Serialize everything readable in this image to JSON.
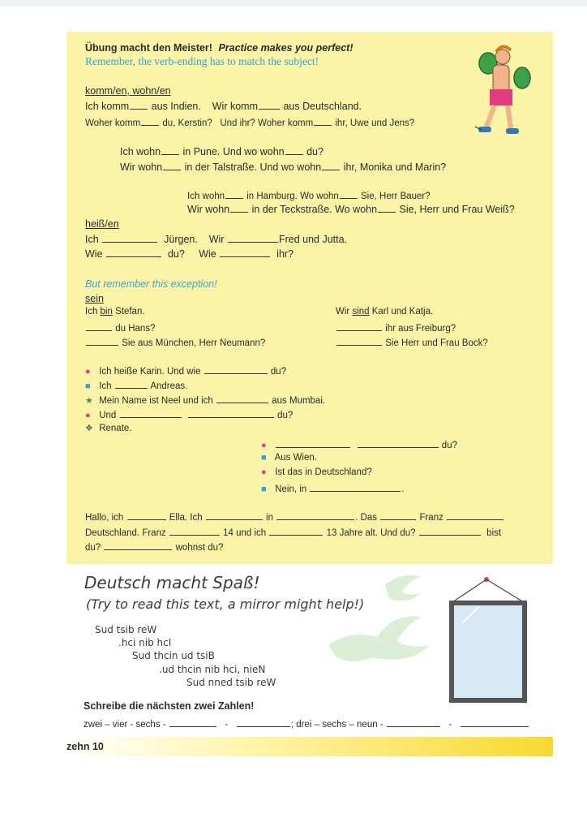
{
  "exercise": {
    "title_de": "Übung macht den Meister!",
    "title_en": "Practice makes you perfect!",
    "reminder": "Remember, the verb-ending has to match the subject!"
  },
  "section_komm": {
    "heading": "komm/en, wohn/en",
    "l1a": "Ich komm",
    "l1b": "aus Indien.",
    "l1c": "Wir komm",
    "l1d": "aus Deutschland.",
    "l2a": "Woher komm",
    "l2b": "du, Kerstin?",
    "l2c": "Und ihr? Woher komm",
    "l2d": "ihr, Uwe und Jens?",
    "l3a": "Ich wohn",
    "l3b": "in Pune. Und wo wohn",
    "l3c": "du?",
    "l4a": "Wir wohn",
    "l4b": "in der Talstraße. Und wo wohn",
    "l4c": "ihr, Monika und Marin?",
    "l5a": "Ich wohn",
    "l5b": "in Hamburg. Wo wohn",
    "l5c": "Sie, Herr Bauer?",
    "l6a": "Wir wohn",
    "l6b": "in der Teckstraße. Wo wohn",
    "l6c": "Sie, Herr und Frau Weiß?"
  },
  "section_heiss": {
    "heading": "heiß/en",
    "l1a": "Ich",
    "l1b": "Jürgen.",
    "l1c": "Wir",
    "l1d": "Fred und Jutta.",
    "l2a": "Wie",
    "l2b": "du?",
    "l2c": "Wie",
    "l2d": "ihr?"
  },
  "section_sein": {
    "exception": "But remember this exception!",
    "heading": "sein",
    "left1a": "Ich ",
    "left1b": "bin",
    "left1c": " Stefan.",
    "left2": "du Hans?",
    "left3": "Sie aus München, Herr Neumann?",
    "right1a": "Wir ",
    "right1b": "sind",
    "right1c": " Karl und Katja.",
    "right2": "ihr aus Freiburg?",
    "right3": "Sie Herr und Frau Bock?"
  },
  "dialogue": {
    "d1a": "Ich heiße Karin. Und wie",
    "d1b": "du?",
    "d2a": "Ich",
    "d2b": "Andreas.",
    "d3a": "Mein Name ist Neel und ich",
    "d3b": "aus Mumbai.",
    "d4a": "Und",
    "d4b": "du?",
    "d5": "Renate.",
    "d6": "du?",
    "d7": "Aus Wien.",
    "d8": "Ist das in Deutschland?",
    "d9a": "Nein, in",
    "d9b": "."
  },
  "paragraph": {
    "p1a": "Hallo, ich",
    "p1b": "Ella. Ich",
    "p1c": "in",
    "p1d": ". Das",
    "p1e": "Franz",
    "p2a": "Deutschland. Franz",
    "p2b": "14 und ich",
    "p2c": "13 Jahre alt. Und du?",
    "p2d": "bist",
    "p3a": "du?",
    "p3b": "wohnst du?"
  },
  "fun": {
    "title": "Deutsch macht Spaß!",
    "subtitle": "(Try to read this text, a mirror might help!)",
    "m1": "Sud tsib reW",
    "m2": ".hci nib hcI",
    "m3": "Sud thcin ud tsiB",
    "m4": ".ud thcin nib hci, nieN",
    "m5": "Sud nned tsib reW"
  },
  "numbers": {
    "heading": "Schreibe die nächsten zwei Zahlen!",
    "seq1": "zwei – vier - sechs -",
    "dash": "-",
    "sep": ";",
    "seq2": "drei – sechs – neun -"
  },
  "footer": {
    "page_label": "zehn 10"
  },
  "colors": {
    "box": "#fbf3a6",
    "accent_blue": "#2fa6d8",
    "bullet_pink": "#e23c7e",
    "bullet_green": "#28955a"
  }
}
